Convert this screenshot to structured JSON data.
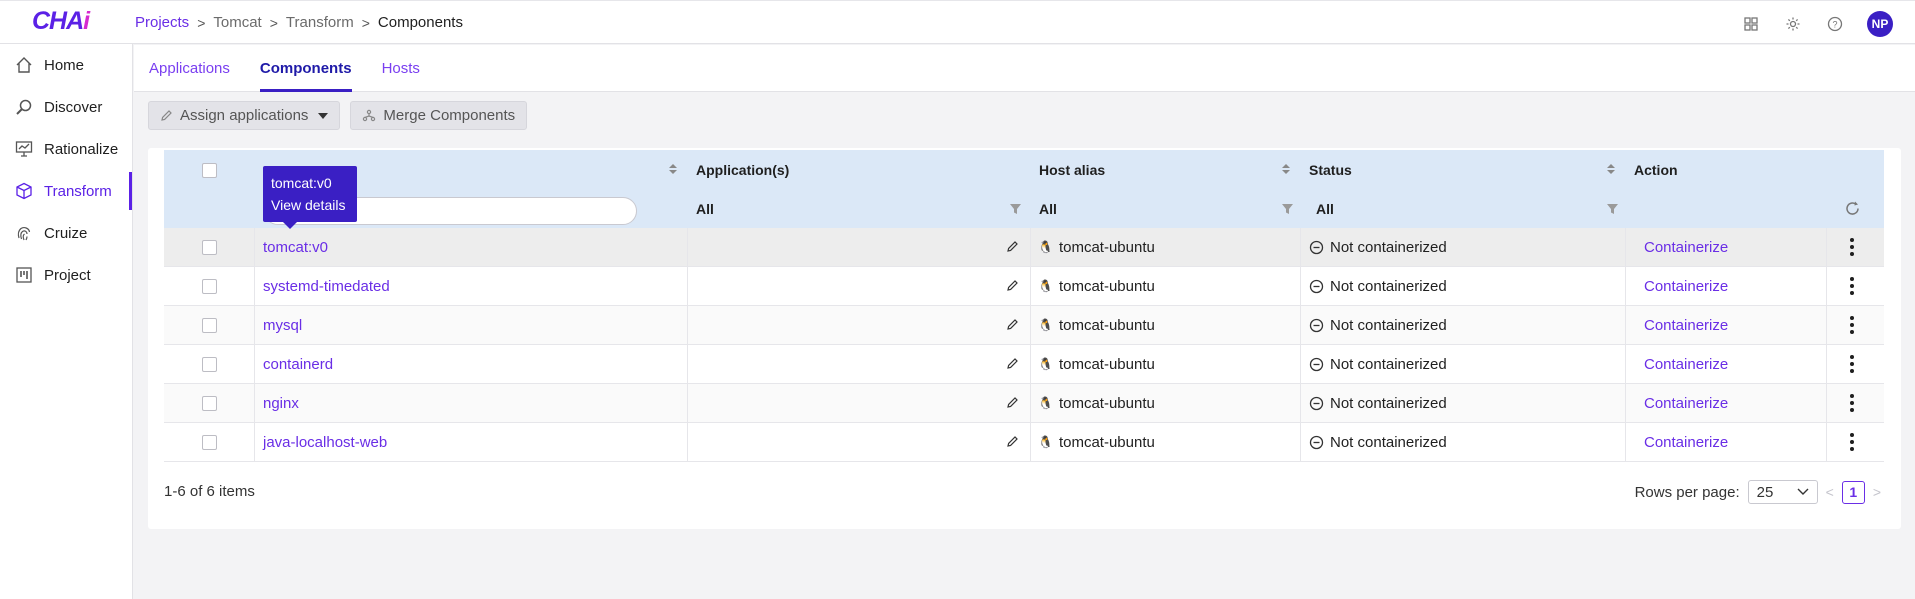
{
  "app": {
    "logo": "CHA",
    "logo_accent": "i"
  },
  "breadcrumb": [
    "Projects",
    "Tomcat",
    "Transform",
    "Components"
  ],
  "header_avatar": "NP",
  "sidebar": {
    "items": [
      {
        "label": "Home",
        "icon": "home-icon"
      },
      {
        "label": "Discover",
        "icon": "magnifier-icon"
      },
      {
        "label": "Rationalize",
        "icon": "presentation-chart-icon"
      },
      {
        "label": "Transform",
        "icon": "cube-icon"
      },
      {
        "label": "Cruize",
        "icon": "fingerprint-icon"
      },
      {
        "label": "Project",
        "icon": "kanban-icon"
      }
    ],
    "active": "Transform"
  },
  "tabs": [
    {
      "label": "Applications"
    },
    {
      "label": "Components"
    },
    {
      "label": "Hosts"
    }
  ],
  "toolbar": {
    "assign_label": "Assign applications",
    "merge_label": "Merge Components"
  },
  "table": {
    "headers": {
      "applications": "Application(s)",
      "host_alias": "Host alias",
      "status": "Status",
      "action": "Action"
    },
    "filters": {
      "applications": "All",
      "host_alias": "All",
      "status": "All"
    },
    "rows": [
      {
        "component": "tomcat:v0",
        "host": "tomcat-ubuntu",
        "status": "Not containerized",
        "action": "Containerize"
      },
      {
        "component": "systemd-timedated",
        "host": "tomcat-ubuntu",
        "status": "Not containerized",
        "action": "Containerize"
      },
      {
        "component": "mysql",
        "host": "tomcat-ubuntu",
        "status": "Not containerized",
        "action": "Containerize"
      },
      {
        "component": "containerd",
        "host": "tomcat-ubuntu",
        "status": "Not containerized",
        "action": "Containerize"
      },
      {
        "component": "nginx",
        "host": "tomcat-ubuntu",
        "status": "Not containerized",
        "action": "Containerize"
      },
      {
        "component": "java-localhost-web",
        "host": "tomcat-ubuntu",
        "status": "Not containerized",
        "action": "Containerize"
      }
    ]
  },
  "tooltip": {
    "title": "tomcat:v0",
    "action": "View details"
  },
  "footer": {
    "count": "1-6 of 6 items",
    "rows_per_page_label": "Rows per page:",
    "rows_per_page_value": "25",
    "current_page": "1"
  }
}
